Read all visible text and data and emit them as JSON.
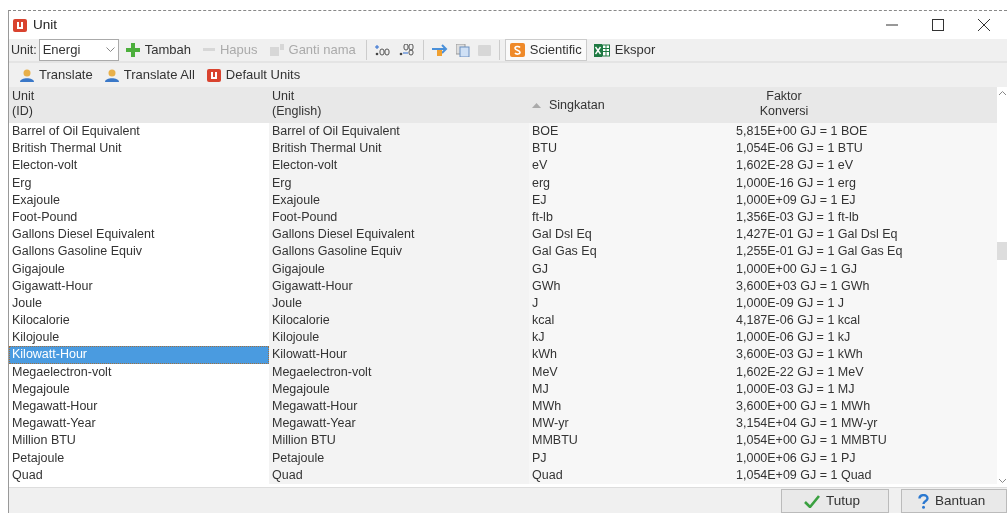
{
  "window": {
    "title": "Unit"
  },
  "toolbar": {
    "unit_label": "Unit:",
    "unit_select": "Energi",
    "items": [
      {
        "kind": "button",
        "label": "Tambah",
        "disabled": false
      },
      {
        "kind": "button",
        "label": "Hapus",
        "disabled": true
      },
      {
        "kind": "button",
        "label": "Ganti nama",
        "disabled": true
      },
      {
        "kind": "separator"
      },
      {
        "kind": "icon",
        "disabled": false
      },
      {
        "kind": "icon",
        "disabled": false
      },
      {
        "kind": "separator"
      },
      {
        "kind": "icon",
        "disabled": false
      },
      {
        "kind": "icon",
        "disabled": false
      },
      {
        "kind": "icon",
        "disabled": true
      },
      {
        "kind": "separator"
      },
      {
        "kind": "toggle",
        "label": "Scientific",
        "selected": true
      },
      {
        "kind": "button",
        "label": "Ekspor",
        "disabled": false
      }
    ]
  },
  "toolbar2": [
    {
      "label": "Translate"
    },
    {
      "label": "Translate All"
    },
    {
      "label": "Default Units"
    }
  ],
  "table": {
    "columns": [
      {
        "label": "Unit",
        "sublabel": "(ID)",
        "sorted": false
      },
      {
        "label": "Unit",
        "sublabel": "(English)",
        "sorted": false
      },
      {
        "label": "Singkatan",
        "sorted": true
      },
      {
        "label": "Faktor",
        "sublabel": "Konversi",
        "sorted": false
      }
    ],
    "rows": [
      {
        "unit_id": "Barrel of Oil Equivalent",
        "unit_en": "Barrel of Oil Equivalent",
        "abbr": "BOE",
        "factor": "5,815E+00 GJ = 1 BOE",
        "selected": false
      },
      {
        "unit_id": "British Thermal Unit",
        "unit_en": "British Thermal Unit",
        "abbr": "BTU",
        "factor": "1,054E-06 GJ = 1 BTU",
        "selected": false
      },
      {
        "unit_id": "Electon-volt",
        "unit_en": "Electon-volt",
        "abbr": "eV",
        "factor": "1,602E-28 GJ = 1 eV",
        "selected": false
      },
      {
        "unit_id": "Erg",
        "unit_en": "Erg",
        "abbr": "erg",
        "factor": "1,000E-16 GJ = 1 erg",
        "selected": false
      },
      {
        "unit_id": "Exajoule",
        "unit_en": "Exajoule",
        "abbr": "EJ",
        "factor": "1,000E+09 GJ = 1 EJ",
        "selected": false
      },
      {
        "unit_id": "Foot-Pound",
        "unit_en": "Foot-Pound",
        "abbr": "ft-lb",
        "factor": "1,356E-03 GJ = 1 ft-lb",
        "selected": false
      },
      {
        "unit_id": "Gallons Diesel Equivalent",
        "unit_en": "Gallons Diesel Equivalent",
        "abbr": "Gal Dsl Eq",
        "factor": "1,427E-01 GJ = 1 Gal Dsl Eq",
        "selected": false
      },
      {
        "unit_id": "Gallons Gasoline Equiv",
        "unit_en": "Gallons Gasoline Equiv",
        "abbr": "Gal Gas Eq",
        "factor": "1,255E-01 GJ = 1 Gal Gas Eq",
        "selected": false
      },
      {
        "unit_id": "Gigajoule",
        "unit_en": "Gigajoule",
        "abbr": "GJ",
        "factor": "1,000E+00 GJ = 1 GJ",
        "selected": false
      },
      {
        "unit_id": "Gigawatt-Hour",
        "unit_en": "Gigawatt-Hour",
        "abbr": "GWh",
        "factor": "3,600E+03 GJ = 1 GWh",
        "selected": false
      },
      {
        "unit_id": "Joule",
        "unit_en": "Joule",
        "abbr": "J",
        "factor": "1,000E-09 GJ = 1 J",
        "selected": false
      },
      {
        "unit_id": "Kilocalorie",
        "unit_en": "Kilocalorie",
        "abbr": "kcal",
        "factor": "4,187E-06 GJ = 1 kcal",
        "selected": false
      },
      {
        "unit_id": "Kilojoule",
        "unit_en": "Kilojoule",
        "abbr": "kJ",
        "factor": "1,000E-06 GJ = 1 kJ",
        "selected": false
      },
      {
        "unit_id": "Kilowatt-Hour",
        "unit_en": "Kilowatt-Hour",
        "abbr": "kWh",
        "factor": "3,600E-03 GJ = 1 kWh",
        "selected": true
      },
      {
        "unit_id": "Megaelectron-volt",
        "unit_en": "Megaelectron-volt",
        "abbr": "MeV",
        "factor": "1,602E-22 GJ = 1 MeV",
        "selected": false
      },
      {
        "unit_id": "Megajoule",
        "unit_en": "Megajoule",
        "abbr": "MJ",
        "factor": "1,000E-03 GJ = 1 MJ",
        "selected": false
      },
      {
        "unit_id": "Megawatt-Hour",
        "unit_en": "Megawatt-Hour",
        "abbr": "MWh",
        "factor": "3,600E+00 GJ = 1 MWh",
        "selected": false
      },
      {
        "unit_id": "Megawatt-Year",
        "unit_en": "Megawatt-Year",
        "abbr": "MW-yr",
        "factor": "3,154E+04 GJ = 1 MW-yr",
        "selected": false
      },
      {
        "unit_id": "Million BTU",
        "unit_en": "Million BTU",
        "abbr": "MMBTU",
        "factor": "1,054E+00 GJ = 1 MMBTU",
        "selected": false
      },
      {
        "unit_id": "Petajoule",
        "unit_en": "Petajoule",
        "abbr": "PJ",
        "factor": "1,000E+06 GJ = 1 PJ",
        "selected": false
      },
      {
        "unit_id": "Quad",
        "unit_en": "Quad",
        "abbr": "Quad",
        "factor": "1,054E+09 GJ = 1 Quad",
        "selected": false
      }
    ]
  },
  "footer": [
    {
      "label": "Tutup"
    },
    {
      "label": "Bantuan"
    }
  ]
}
